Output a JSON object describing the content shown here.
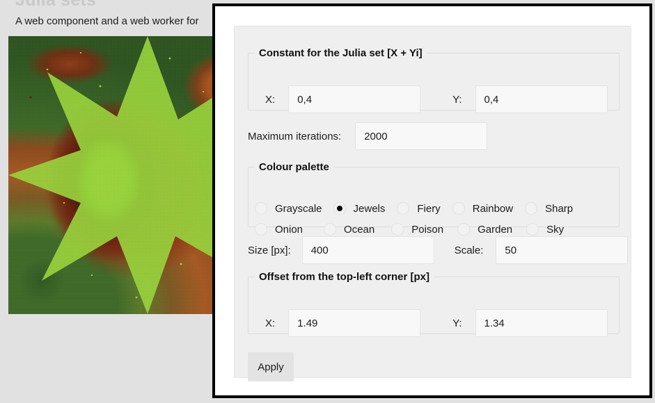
{
  "page": {
    "title": "Julia sets",
    "subtitle": "A web component and a web worker for"
  },
  "fractal": {
    "alt": "julia-set-fractal-preview",
    "colors": {
      "green": "#3f6b27",
      "rust": "#a8541d",
      "dark_red": "#6b1d0c",
      "lime": "#9bd63c",
      "yellow": "#e0d33a"
    }
  },
  "dialog": {
    "julia": {
      "legend": "Constant for the Julia set [X + Yi]",
      "x_label": "X:",
      "x_value": "0,4",
      "y_label": "Y:",
      "y_value": "0,4"
    },
    "iterations": {
      "label": "Maximum iterations:",
      "value": "2000"
    },
    "palette": {
      "legend": "Colour palette",
      "selected": "Jewels",
      "rows": [
        [
          "Grayscale",
          "Jewels",
          "Fiery",
          "Rainbow",
          "Sharp"
        ],
        [
          "Onion",
          "Ocean",
          "Poison",
          "Garden",
          "Sky"
        ]
      ]
    },
    "size": {
      "size_label": "Size [px]:",
      "size_value": "400",
      "scale_label": "Scale:",
      "scale_value": "50"
    },
    "offset": {
      "legend": "Offset from the top-left corner [px]",
      "x_label": "X:",
      "x_value": "1.49",
      "y_label": "Y:",
      "y_value": "1.34"
    },
    "apply_label": "Apply"
  }
}
